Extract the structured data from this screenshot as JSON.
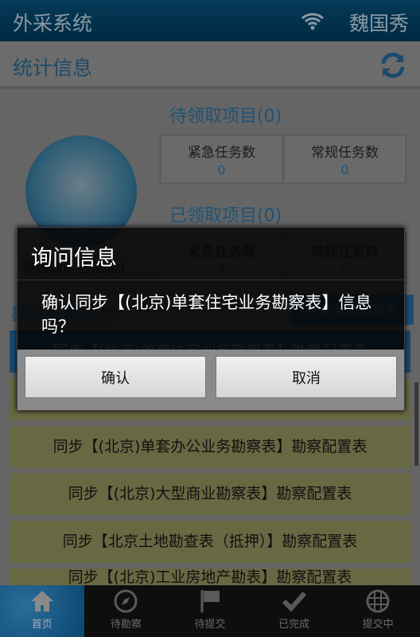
{
  "header": {
    "app_title": "外采系统",
    "user": "魏国秀"
  },
  "section": {
    "title": "统计信息"
  },
  "stats": {
    "logo_summary_label1": "待领取",
    "logo_summary_val1": "0",
    "logo_summary_label2": "/已完成",
    "logo_summary_val2": "9",
    "pending": {
      "title": "待领取项目(0)",
      "urgent_label": "紧急任务数",
      "urgent": "0",
      "normal_label": "常规任务数",
      "normal": "0"
    },
    "claimed": {
      "title": "已领取项目(0)",
      "urgent_label": "紧急任务数",
      "urgent": "3",
      "normal_label": "常规任务数",
      "normal": "6"
    }
  },
  "config": {
    "title": "勘察配置信息",
    "sync_all": "同步全部勘察表",
    "items": [
      "同步【(北京)单套住宅业务勘察表】勘察配置表",
      "",
      "同步【(北京)单套办公业务勘察表】勘察配置表",
      "同步【(北京)大型商业勘察表】勘察配置表",
      "同步【北京土地勘查表（抵押）】勘察配置表",
      "同步【(北京)工业房地产勘表】勘察配置表"
    ]
  },
  "nav": [
    "首页",
    "待勘察",
    "待提交",
    "已完成",
    "提交中"
  ],
  "dialog": {
    "title": "询问信息",
    "message": "确认同步【(北京)单套住宅业务勘察表】信息吗？",
    "confirm": "确认",
    "cancel": "取消"
  }
}
